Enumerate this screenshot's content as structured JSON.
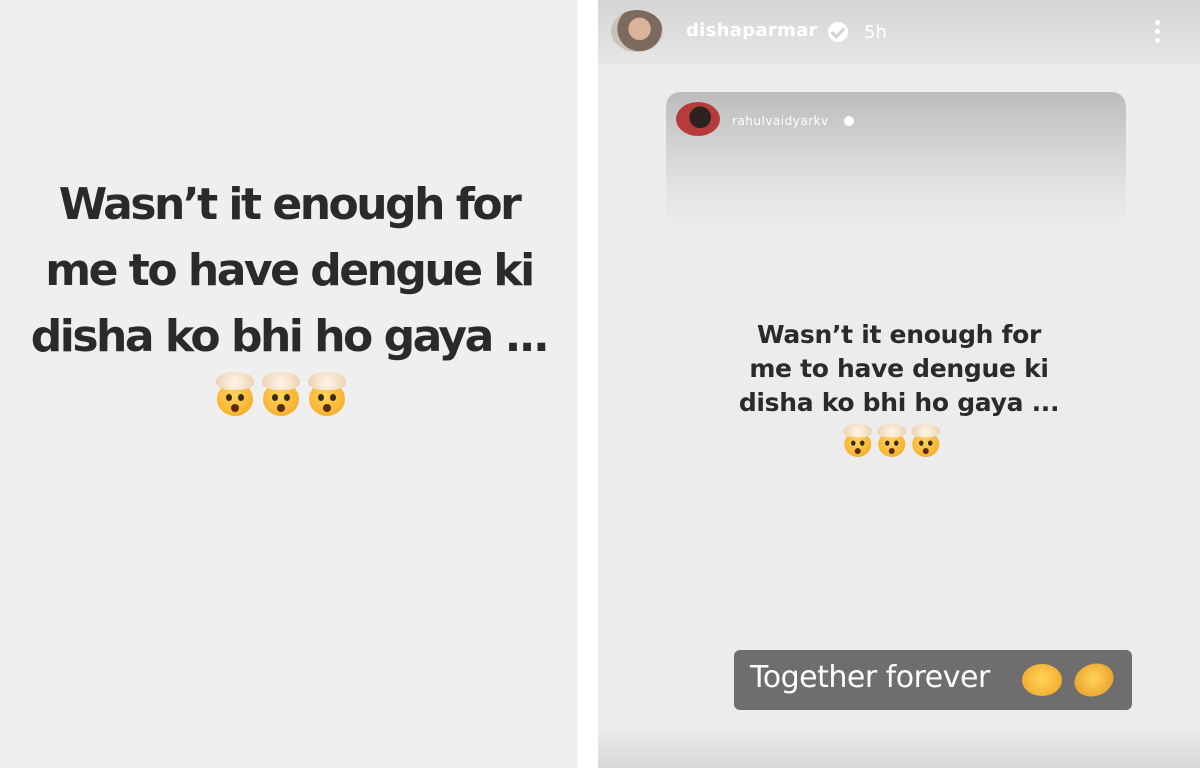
{
  "left_story": {
    "lines": [
      "Wasn’t it enough for",
      "me to have dengue ki",
      "disha ko bhi ho gaya ..."
    ],
    "emoji_icon": "exploding-head-icon",
    "emoji_count": 3
  },
  "right_story": {
    "header": {
      "username": "dishaparmar",
      "time_ago": "5h",
      "verified_icon": "verified-badge-icon",
      "menu_icon": "more-vertical-icon"
    },
    "reshared_post": {
      "username": "rahulvaidyarkv",
      "verified_icon": "verified-badge-icon",
      "lines": [
        "Wasn’t it enough for",
        "me to have dengue ki",
        "disha ko bhi ho gaya ..."
      ],
      "emoji_icon": "exploding-head-icon",
      "emoji_count": 3
    },
    "caption": {
      "text": "Together forever",
      "emojis": [
        "melting-face-icon",
        "rofl-icon"
      ]
    }
  }
}
